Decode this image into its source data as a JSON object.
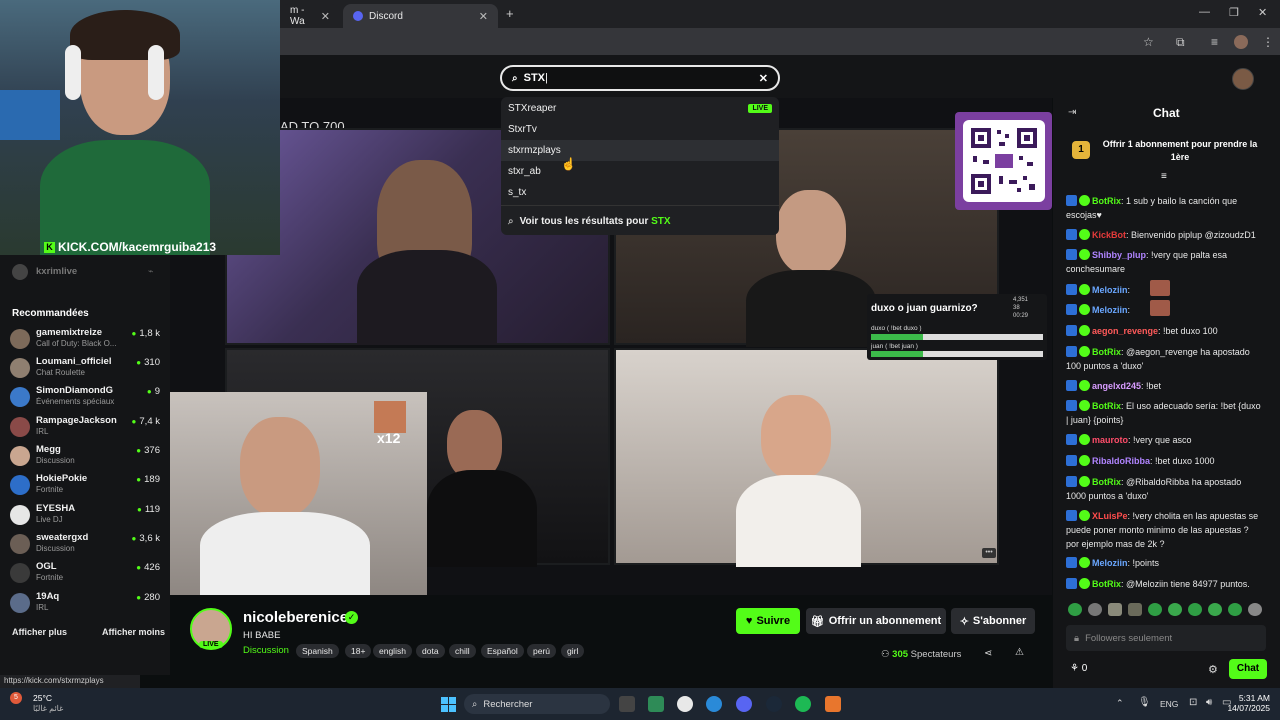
{
  "browser": {
    "tabs": [
      {
        "label": "m - Wa"
      },
      {
        "label": "Discord"
      }
    ],
    "new_tab": "+",
    "window": {
      "min": "—",
      "max": "❐",
      "close": "✕"
    }
  },
  "webcam_overlay": {
    "url_text": "KICK.COM/kacemrguiba213"
  },
  "search": {
    "value": "STX",
    "clear": "✕",
    "results": [
      {
        "label": "STXreaper",
        "live": "LIVE"
      },
      {
        "label": "StxrTv"
      },
      {
        "label": "stxrmzplays"
      },
      {
        "label": "stxr_ab"
      },
      {
        "label": "s_tx"
      }
    ],
    "see_all_prefix": "Voir tous les résultats pour",
    "see_all_query": "STX"
  },
  "stream_overlay": {
    "goal_text": "AD TO 700",
    "poll": {
      "question": "duxo o juan guarnizo?",
      "viewers": "4,351",
      "count": "38",
      "timer": "00:29",
      "options": [
        {
          "label": "duxo ( !bet duxo )",
          "fraction": 0.3
        },
        {
          "label": "juan ( !bet juan )",
          "fraction": 0.3
        }
      ]
    },
    "multiplier": "x12"
  },
  "sidebar": {
    "top_partial": "kxrimlive",
    "section_title": "Recommandées",
    "items": [
      {
        "name": "gamemixtreize",
        "category": "Call of Duty: Black O...",
        "count": "1,8 k",
        "color": "#7d6a5a"
      },
      {
        "name": "Loumani_officiel",
        "category": "Chat Roulette",
        "count": "310",
        "color": "#8f7f70"
      },
      {
        "name": "SimonDiamondG",
        "category": "Événements spéciaux",
        "count": "9",
        "color": "#3b79c9"
      },
      {
        "name": "RampageJackson",
        "category": "IRL",
        "count": "7,4 k",
        "color": "#8a4a48"
      },
      {
        "name": "Megg",
        "category": "Discussion",
        "count": "376",
        "color": "#c9a690"
      },
      {
        "name": "HokiePokie",
        "category": "Fortnite",
        "count": "189",
        "color": "#2d6ec9"
      },
      {
        "name": "EYESHA",
        "category": "Live DJ",
        "count": "119",
        "color": "#e6e6e6"
      },
      {
        "name": "sweatergxd",
        "category": "Discussion",
        "count": "3,6 k",
        "color": "#6b5e55"
      },
      {
        "name": "OGL",
        "category": "Fortnite",
        "count": "426",
        "color": "#3a3a3a"
      },
      {
        "name": "19Aq",
        "category": "IRL",
        "count": "280",
        "color": "#5b6c8a"
      }
    ],
    "show_more": "Afficher plus",
    "show_less": "Afficher moins"
  },
  "status_url": "https://kick.com/stxrmzplays",
  "streamer": {
    "name": "nicoleberenice",
    "title": "HI BABE",
    "category": "Discussion",
    "live": "LIVE",
    "tags": [
      "Spanish",
      "18+",
      "english",
      "dota",
      "chill",
      "Español",
      "perú",
      "girl"
    ],
    "follow": "Suivre",
    "gift": "Offrir un abonnement",
    "subscribe": "S'abonner",
    "viewers_count": "305",
    "viewers_label": "Spectateurs"
  },
  "chat": {
    "title": "Chat",
    "pinned_num": "1",
    "pinned": "Offrir 1 abonnement pour prendre la 1ère",
    "messages": [
      {
        "user": "BotRix",
        "color": "#53fc18",
        "text": "1 sub y bailo la canción que escojas♥"
      },
      {
        "user": "KickBot",
        "color": "#e63b3b",
        "text": "Bienvenido piplup @zizoudzD1"
      },
      {
        "user": "Shibby_plup",
        "color": "#b084ff",
        "text": "!very que palta esa conchesumare"
      },
      {
        "user": "Meloziin",
        "color": "#6aa7ff",
        "text": ""
      },
      {
        "user": "Meloziin",
        "color": "#6aa7ff",
        "text": ""
      },
      {
        "user": "aegon_revenge",
        "color": "#ff5a5a",
        "text": "!bet duxo 100"
      },
      {
        "user": "BotRix",
        "color": "#53fc18",
        "text": "@aegon_revenge ha apostado 100 puntos a 'duxo'"
      },
      {
        "user": "angelxd245",
        "color": "#d89cff",
        "text": "!bet"
      },
      {
        "user": "BotRix",
        "color": "#53fc18",
        "text": "El uso adecuado sería: !bet {duxo | juan} {points}"
      },
      {
        "user": "mauroto",
        "color": "#ff4d6a",
        "text": "!very que asco"
      },
      {
        "user": "RibaldoRibba",
        "color": "#b084ff",
        "text": "!bet duxo 1000"
      },
      {
        "user": "BotRix",
        "color": "#53fc18",
        "text": "@RibaldoRibba ha apostado 1000 puntos a 'duxo'"
      },
      {
        "user": "XLuisPe",
        "color": "#ff4d4d",
        "text": "!very cholita en las apuestas se puede poner monto minimo de las apuestas ? por ejemplo mas de 2k ?"
      },
      {
        "user": "Meloziin",
        "color": "#6aa7ff",
        "text": "!points"
      },
      {
        "user": "BotRix",
        "color": "#53fc18",
        "text": "@Meloziin tiene 84977 puntos."
      }
    ],
    "input_placeholder": "Followers seulement",
    "points": "0",
    "send": "Chat"
  },
  "taskbar": {
    "weather_temp": "25°C",
    "weather_desc": "غائم غالبًا",
    "notif_count": "5",
    "search": "Rechercher",
    "lang": "ENG",
    "time": "5:31 AM",
    "date": "14/07/2025"
  },
  "colors": {
    "kick_green": "#53fc18",
    "bg": "#0b0e0f",
    "panel": "#141517"
  }
}
